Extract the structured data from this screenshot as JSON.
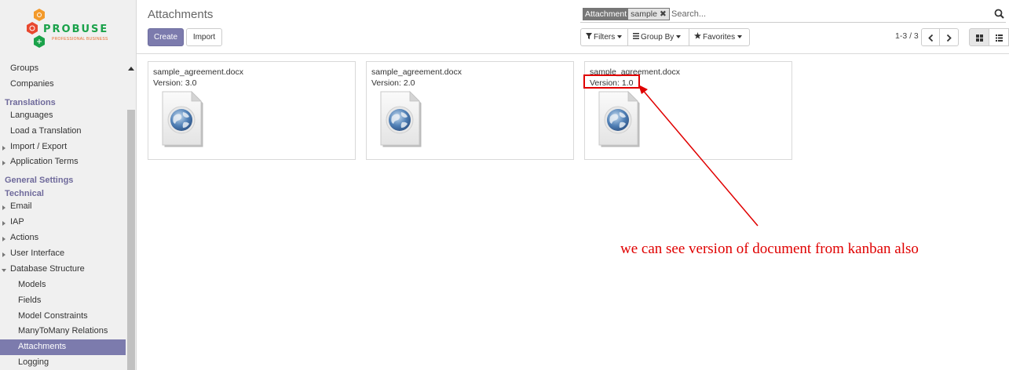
{
  "logo": {
    "brand": "PROBUSE",
    "tagline": "PROFESSIONAL BUSINESS"
  },
  "sidebar": {
    "items": [
      {
        "label": "Groups",
        "level": 1
      },
      {
        "label": "Companies",
        "level": 1
      },
      {
        "label": "Translations",
        "section": true
      },
      {
        "label": "Languages",
        "level": 1
      },
      {
        "label": "Load a Translation",
        "level": 1
      },
      {
        "label": "Import / Export",
        "level": 1,
        "collapsed": true
      },
      {
        "label": "Application Terms",
        "level": 1,
        "collapsed": true
      },
      {
        "label": "General Settings",
        "section": true
      },
      {
        "label": "Technical",
        "section": true
      },
      {
        "label": "Email",
        "level": 1,
        "collapsed": true
      },
      {
        "label": "IAP",
        "level": 1,
        "collapsed": true
      },
      {
        "label": "Actions",
        "level": 1,
        "collapsed": true
      },
      {
        "label": "User Interface",
        "level": 1,
        "collapsed": true
      },
      {
        "label": "Database Structure",
        "level": 1,
        "expanded": true
      },
      {
        "label": "Models",
        "level": 2
      },
      {
        "label": "Fields",
        "level": 2
      },
      {
        "label": "Model Constraints",
        "level": 2
      },
      {
        "label": "ManyToMany Relations",
        "level": 2
      },
      {
        "label": "Attachments",
        "level": 2,
        "active": true
      },
      {
        "label": "Logging",
        "level": 2
      }
    ]
  },
  "page": {
    "title": "Attachments"
  },
  "toolbar": {
    "create_label": "Create",
    "import_label": "Import"
  },
  "search": {
    "facet_category": "Attachment",
    "facet_value": "sample",
    "facet_remove": "✖",
    "placeholder": "Search..."
  },
  "filters": {
    "filters_label": "Filters",
    "groupby_label": "Group By",
    "favorites_label": "Favorites"
  },
  "pager": {
    "value": "1-3 / 3"
  },
  "cards": [
    {
      "name": "sample_agreement.docx",
      "version": "Version: 3.0"
    },
    {
      "name": "sample_agreement.docx",
      "version": "Version: 2.0"
    },
    {
      "name": "sample_agreement.docx",
      "version": "Version: 1.0"
    }
  ],
  "annotation": {
    "text": "we can see version of document from kanban also",
    "color": "#e00000"
  },
  "colors": {
    "primary": "#7c7bad",
    "annotation": "#e00000"
  }
}
